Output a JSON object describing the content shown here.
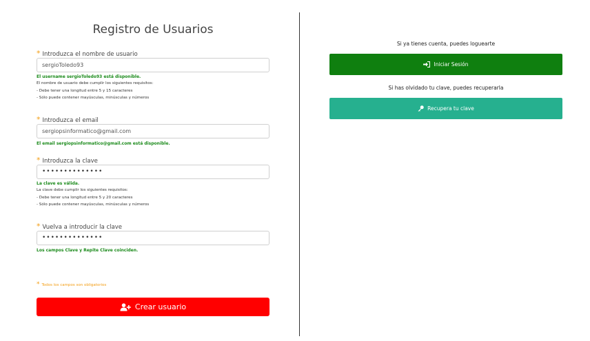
{
  "form": {
    "title": "Registro de Usuarios",
    "required_star": "*",
    "username": {
      "label": "Introduzca el nombre de usuario",
      "value": "sergioToledo93",
      "status": "El username sergioToledo93 está disponible.",
      "requirements": [
        "El nombre de usuario debe cumplir los siguientes requisitos:",
        "- Debe tener una longitud entre 5 y 15 caracteres",
        "- Sólo puede contener mayúsculas, minúsculas y números"
      ]
    },
    "email": {
      "label": "Introduzca el email",
      "value": "sergiopsinformatico@gmail.com",
      "status": "El email sergiopsinformatico@gmail.com está disponible."
    },
    "password": {
      "label": "Introduzca la clave",
      "value": "••••••••••••••",
      "status": "La clave es válida.",
      "requirements": [
        "La clave debe cumplir los siguientes requisitos:",
        "- Debe tener una longitud entre 5 y 20 caracteres",
        "- Sólo puede contener mayúsculas, minúsculas y números"
      ]
    },
    "repeat_password": {
      "label": "Vuelva a introducir la clave",
      "value": "••••••••••••••",
      "status": "Los campos Clave y Repite Clave coinciden."
    },
    "required_note": "Todos los campos son obligatorios",
    "submit_label": "Crear usuario",
    "submit_icon": "user-plus-icon",
    "submit_color": "#ff0000"
  },
  "side": {
    "login_prompt": "Si ya tienes cuenta, puedes loguearte",
    "login_label": "Iniciar Sesión",
    "login_icon": "sign-in-icon",
    "login_color": "#0f7f0f",
    "recover_prompt": "Si has olvidado tu clave, puedes recuperarla",
    "recover_label": "Recupera tu clave",
    "recover_icon": "key-icon",
    "recover_color": "#26b08f"
  }
}
